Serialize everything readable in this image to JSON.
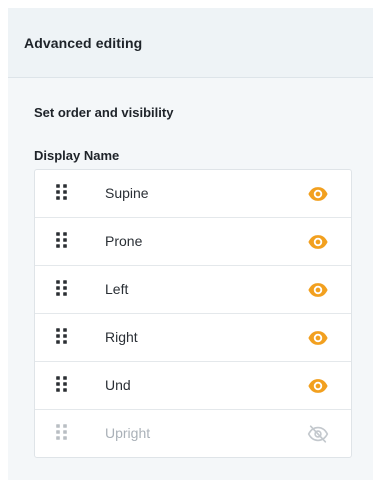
{
  "panel": {
    "title": "Advanced editing"
  },
  "section": {
    "title": "Set order and visibility",
    "column_header": "Display Name"
  },
  "items": [
    {
      "label": "Supine",
      "visible": true,
      "icon": "eye-icon"
    },
    {
      "label": "Prone",
      "visible": true,
      "icon": "eye-icon"
    },
    {
      "label": "Left",
      "visible": true,
      "icon": "eye-icon"
    },
    {
      "label": "Right",
      "visible": true,
      "icon": "eye-icon"
    },
    {
      "label": "Und",
      "visible": true,
      "icon": "eye-icon"
    },
    {
      "label": "Upright",
      "visible": false,
      "icon": "eye-off-icon"
    }
  ],
  "colors": {
    "visible_icon": "#f2a01f",
    "hidden_icon": "#c3c8cd",
    "handle": "#2b2f33",
    "handle_disabled": "#b9bec3"
  }
}
